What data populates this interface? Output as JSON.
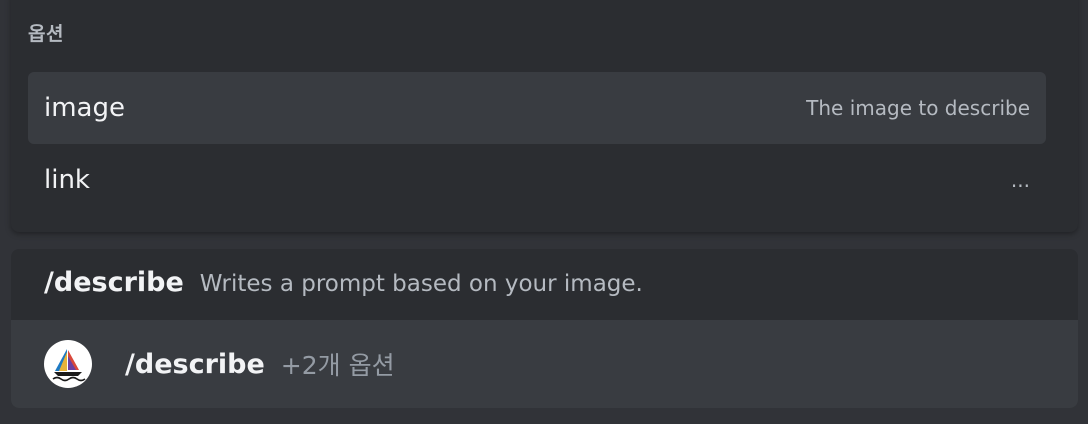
{
  "options_popup": {
    "header": "옵션",
    "options": [
      {
        "name": "image",
        "description": "The image to describe"
      },
      {
        "name": "link",
        "description": "..."
      }
    ]
  },
  "command_panel": {
    "title": "/describe",
    "description": "Writes a prompt based on your image.",
    "suggestion": {
      "command": "/describe",
      "extra_options": "+2개 옵션",
      "avatar_icon": "sailboat-icon"
    }
  },
  "colors": {
    "background": "#313338",
    "panel": "#2b2d31",
    "selected_row": "#393c41",
    "text_primary": "#f2f3f5",
    "text_secondary": "#b5bac1"
  }
}
